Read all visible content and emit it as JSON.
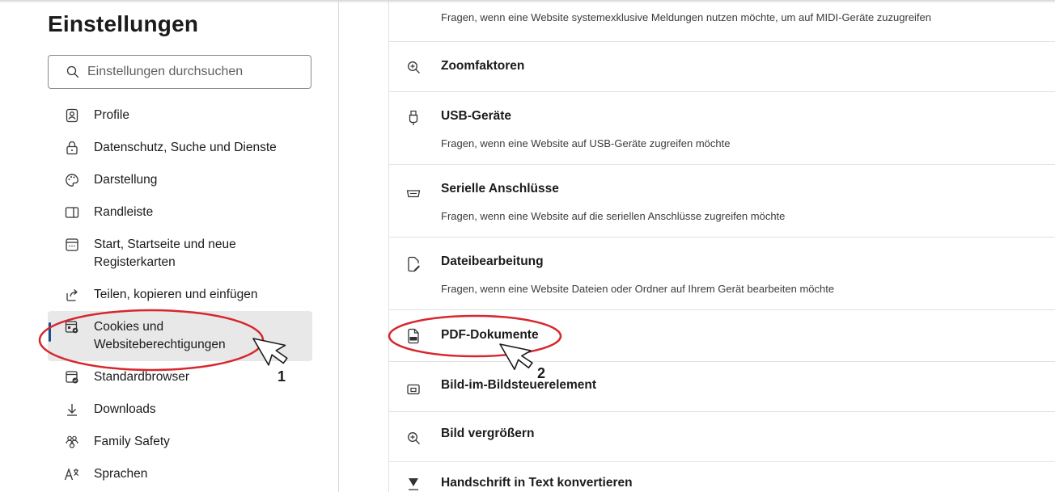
{
  "sidebar": {
    "title": "Einstellungen",
    "search_placeholder": "Einstellungen durchsuchen",
    "items": [
      {
        "label": "Profile",
        "icon": "profile-icon"
      },
      {
        "label": "Datenschutz, Suche und Dienste",
        "icon": "lock-icon"
      },
      {
        "label": "Darstellung",
        "icon": "palette-icon"
      },
      {
        "label": "Randleiste",
        "icon": "sidebar-icon"
      },
      {
        "label": "Start, Startseite und neue Registerkarten",
        "icon": "home-tab-icon"
      },
      {
        "label": "Teilen, kopieren und einfügen",
        "icon": "share-icon"
      },
      {
        "label": "Cookies und Websiteberechtigungen",
        "icon": "cookies-permissions-icon",
        "active": true
      },
      {
        "label": "Standardbrowser",
        "icon": "default-browser-icon"
      },
      {
        "label": "Downloads",
        "icon": "download-icon"
      },
      {
        "label": "Family Safety",
        "icon": "family-icon"
      },
      {
        "label": "Sprachen",
        "icon": "language-icon"
      }
    ]
  },
  "content": {
    "rows": [
      {
        "title": "",
        "desc": "Fragen, wenn eine Website systemexklusive Meldungen nutzen möchte, um auf MIDI-Geräte zuzugreifen",
        "icon": ""
      },
      {
        "title": "Zoomfaktoren",
        "desc": "",
        "icon": "zoom-icon"
      },
      {
        "title": "USB-Geräte",
        "desc": "Fragen, wenn eine Website auf USB-Geräte zugreifen möchte",
        "icon": "usb-icon"
      },
      {
        "title": "Serielle Anschlüsse",
        "desc": "Fragen, wenn eine Website auf die seriellen Anschlüsse zugreifen möchte",
        "icon": "serial-port-icon"
      },
      {
        "title": "Dateibearbeitung",
        "desc": "Fragen, wenn eine Website Dateien oder Ordner auf Ihrem Gerät bearbeiten möchte",
        "icon": "file-edit-icon"
      },
      {
        "title": "PDF-Dokumente",
        "desc": "",
        "icon": "pdf-icon"
      },
      {
        "title": "Bild-im-Bildsteuerelement",
        "desc": "",
        "icon": "picture-in-picture-icon"
      },
      {
        "title": "Bild vergrößern",
        "desc": "",
        "icon": "zoom-icon"
      },
      {
        "title": "Handschrift in Text konvertieren",
        "desc": "",
        "icon": "handwriting-icon"
      }
    ]
  },
  "annotations": {
    "step1": "1",
    "step2": "2",
    "circle_color": "#d7262e"
  }
}
